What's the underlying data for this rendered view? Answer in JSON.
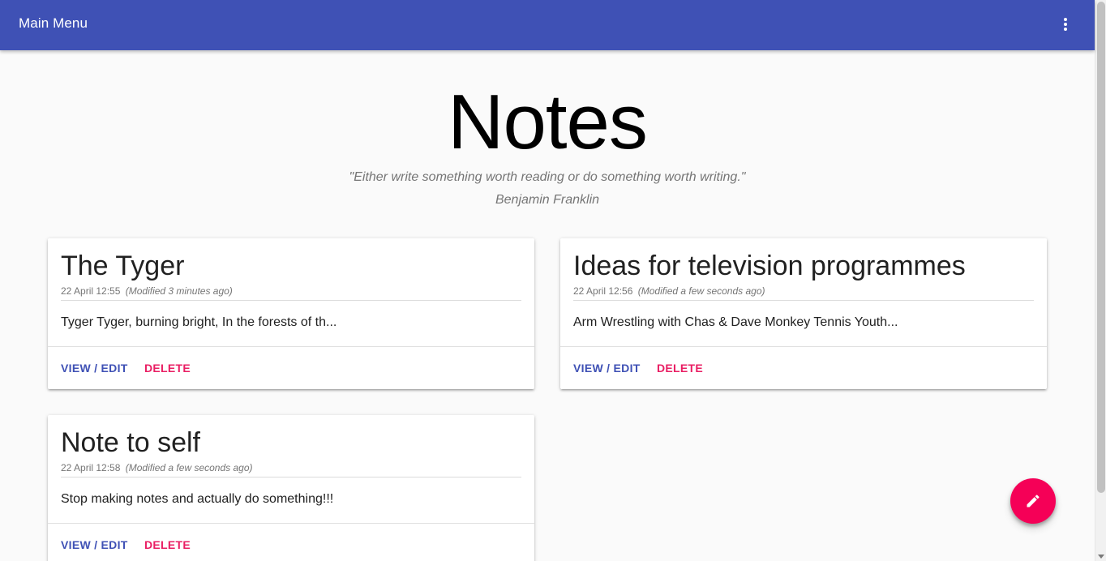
{
  "appbar": {
    "title": "Main Menu",
    "menu_icon": "more-vert-icon",
    "color": "#3f51b5"
  },
  "hero": {
    "title": "Notes",
    "quote": "\"Either write something worth reading or do something worth writing.\"",
    "author": "Benjamin Franklin"
  },
  "notes": [
    {
      "title": "The Tyger",
      "date": "22 April 12:55",
      "modified": "(Modified 3 minutes ago)",
      "preview": "Tyger Tyger, burning bright, In the forests of th...",
      "view_label": "VIEW / EDIT",
      "delete_label": "DELETE"
    },
    {
      "title": "Ideas for television programmes",
      "date": "22 April 12:56",
      "modified": "(Modified a few seconds ago)",
      "preview": "Arm Wrestling with Chas & Dave Monkey Tennis Youth...",
      "view_label": "VIEW / EDIT",
      "delete_label": "DELETE"
    },
    {
      "title": "Note to self",
      "date": "22 April 12:58",
      "modified": "(Modified a few seconds ago)",
      "preview": "Stop making notes and actually do something!!!",
      "view_label": "VIEW / EDIT",
      "delete_label": "DELETE"
    }
  ],
  "fab": {
    "icon": "pencil-icon",
    "color": "#f50057"
  },
  "colors": {
    "primary": "#3f51b5",
    "accent": "#e91e63"
  }
}
